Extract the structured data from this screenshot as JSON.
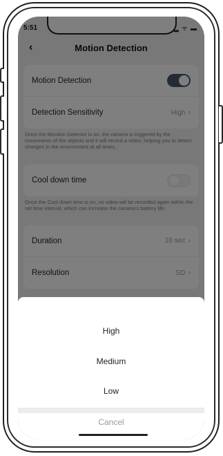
{
  "status": {
    "time": "5:51",
    "icons": "▂ ᯤ ▬"
  },
  "nav": {
    "back": "‹",
    "title": "Motion Detection"
  },
  "settings": {
    "motion_detection_label": "Motion Detection",
    "motion_detection_on": true,
    "sensitivity_label": "Detection Sensitivity",
    "sensitivity_value": "High",
    "motion_note": "Once the Montion Detector is on, the camera is triggered by the movements of the objects and it will record a video, helping you to detect changes in the environment at all times.",
    "cooldown_label": "Cool down time",
    "cooldown_on": false,
    "cooldown_note": "Once the Cool down time is on, no video will be recorded again within the set time interval, which can increase the camera's battery life.",
    "duration_label": "Duration",
    "duration_value": "10 sec",
    "resolution_label": "Resolution",
    "resolution_value": "SD",
    "chevron": "›"
  },
  "sheet": {
    "options": [
      "High",
      "Medium",
      "Low"
    ],
    "cancel": "Cancel"
  }
}
